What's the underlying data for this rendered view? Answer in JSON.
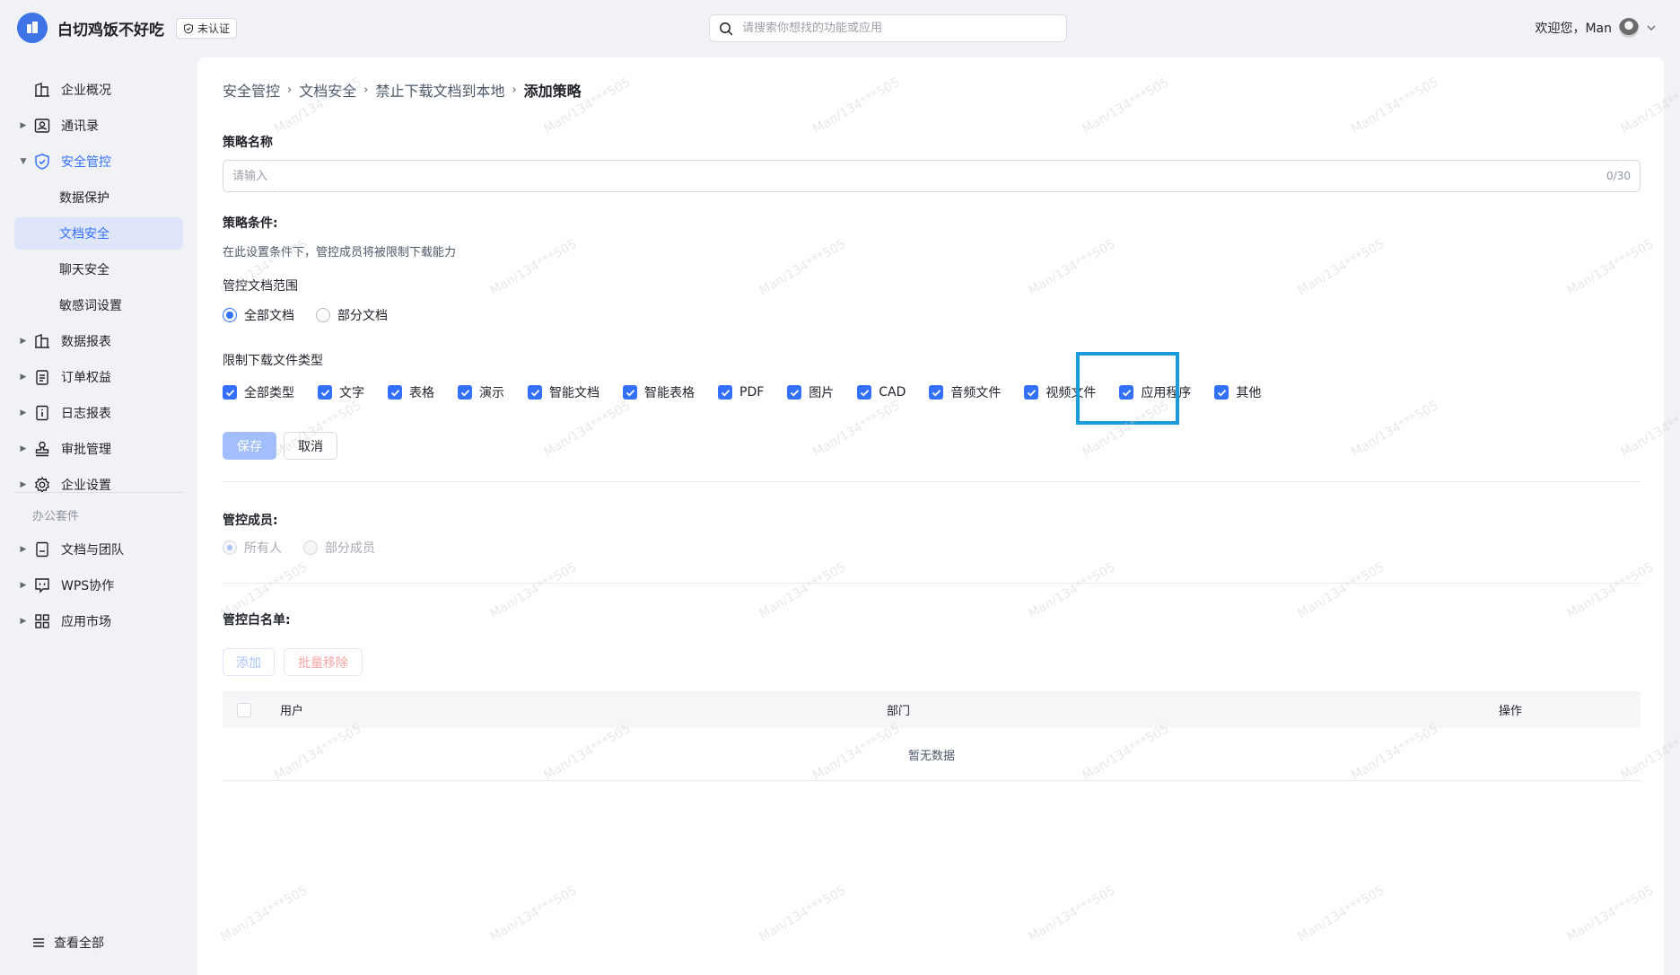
{
  "header": {
    "org_name": "白切鸡饭不好吃",
    "cert_badge": "未认证",
    "search_placeholder": "请搜索你想找的功能或应用",
    "welcome": "欢迎您，Man"
  },
  "sidebar": {
    "items": [
      {
        "label": "企业概况"
      },
      {
        "label": "通讯录"
      },
      {
        "label": "安全管控"
      },
      {
        "label": "数据保护"
      },
      {
        "label": "文档安全"
      },
      {
        "label": "聊天安全"
      },
      {
        "label": "敏感词设置"
      },
      {
        "label": "数据报表"
      },
      {
        "label": "订单权益"
      },
      {
        "label": "日志报表"
      },
      {
        "label": "审批管理"
      },
      {
        "label": "企业设置"
      }
    ],
    "group_label": "办公套件",
    "group_items": [
      {
        "label": "文档与团队"
      },
      {
        "label": "WPS协作"
      },
      {
        "label": "应用市场"
      }
    ],
    "view_all": "查看全部"
  },
  "breadcrumb": [
    "安全管控",
    "文档安全",
    "禁止下载文档到本地",
    "添加策略"
  ],
  "form": {
    "policy_name_label": "策略名称",
    "policy_name_placeholder": "请输入",
    "policy_name_counter": "0/30",
    "conditions_label": "策略条件:",
    "conditions_desc": "在此设置条件下，管控成员将被限制下载能力",
    "scope_label": "管控文档范围",
    "scope_options": [
      "全部文档",
      "部分文档"
    ],
    "filetype_label": "限制下载文件类型",
    "filetypes": [
      "全部类型",
      "文字",
      "表格",
      "演示",
      "智能文档",
      "智能表格",
      "PDF",
      "图片",
      "CAD",
      "音频文件",
      "视频文件",
      "应用程序",
      "其他"
    ],
    "save": "保存",
    "cancel": "取消",
    "members_label": "管控成员:",
    "member_options": [
      "所有人",
      "部分成员"
    ],
    "whitelist_label": "管控白名单:",
    "add": "添加",
    "batch_remove": "批量移除"
  },
  "table": {
    "columns": [
      "用户",
      "部门",
      "操作"
    ],
    "empty": "暂无数据"
  },
  "watermark": "Man/134***505"
}
